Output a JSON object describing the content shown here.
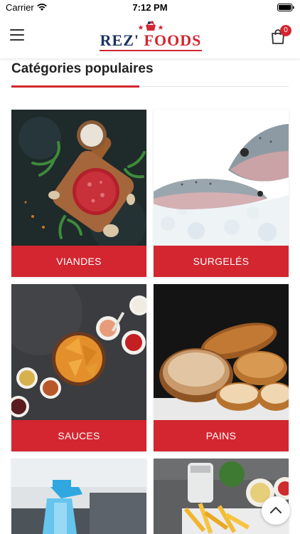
{
  "status_bar": {
    "carrier": "Carrier",
    "time": "7:12 PM"
  },
  "header": {
    "logo": {
      "part1": "REZ'",
      "part2": " FOODS"
    },
    "cart_count": "0"
  },
  "section": {
    "title": "Catégories populaires"
  },
  "categories": [
    {
      "label": "VIANDES",
      "icon": "raw-meat-photo"
    },
    {
      "label": "SURGELÉS",
      "icon": "frozen-fish-photo"
    },
    {
      "label": "SAUCES",
      "icon": "sauces-nachos-photo"
    },
    {
      "label": "PAINS",
      "icon": "bread-photo"
    },
    {
      "label": "",
      "icon": "cleaning-spray-photo"
    },
    {
      "label": "",
      "icon": "fries-dips-photo"
    }
  ],
  "colors": {
    "accent": "#d32630",
    "brand_blue": "#1d3262"
  }
}
